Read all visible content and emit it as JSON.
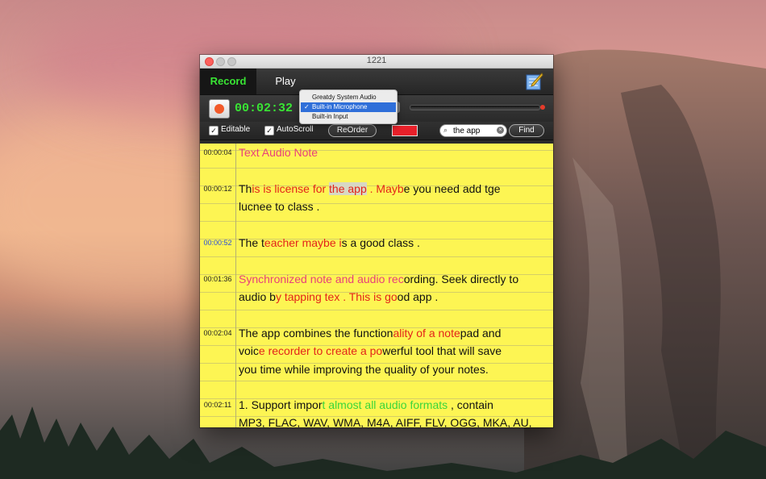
{
  "window": {
    "title": "1221"
  },
  "tabs": {
    "record": "Record",
    "play": "Play"
  },
  "transport": {
    "timer": "00:02:32"
  },
  "options": {
    "editable_label": "Editable",
    "autoscroll_label": "AutoScroll",
    "reorder_label": "ReOrder",
    "find_label": "Find",
    "search_value": "the app",
    "highlight_color": "#e8202a"
  },
  "input_menu": {
    "items": [
      "Greatdy System Audio",
      "Built-in Microphone",
      "Built-in Input"
    ],
    "selected": "Built-in Microphone"
  },
  "notes": [
    {
      "time": "00:00:04",
      "segments": [
        {
          "t": "Text Audio Note",
          "c": "pink"
        }
      ]
    },
    {
      "time": "00:00:12",
      "segments": [
        {
          "t": "Th",
          "c": "black"
        },
        {
          "t": "is is license for ",
          "c": "red"
        },
        {
          "t": "the app",
          "c": "red",
          "hl": true
        },
        {
          "t": "  .  Mayb",
          "c": "red"
        },
        {
          "t": "e you need add tge",
          "c": "black"
        },
        {
          "br": true
        },
        {
          "t": "lucnee to class .",
          "c": "black"
        }
      ]
    },
    {
      "time": "00:00:52",
      "time_color": "blue",
      "segments": [
        {
          "t": "The t",
          "c": "black"
        },
        {
          "t": "eacher maybe i",
          "c": "red"
        },
        {
          "t": "s a good class .",
          "c": "black"
        }
      ]
    },
    {
      "time": "00:01:36",
      "segments": [
        {
          "t": "Synchronized note and audio rec",
          "c": "pink"
        },
        {
          "t": "ording. Seek directly to",
          "c": "black"
        },
        {
          "br": true
        },
        {
          "t": "audio b",
          "c": "black"
        },
        {
          "t": "y tapping tex . This is go",
          "c": "red"
        },
        {
          "t": "od app .",
          "c": "black"
        }
      ]
    },
    {
      "time": "00:02:04",
      "segments": [
        {
          "t": "The app combines the function",
          "c": "black"
        },
        {
          "t": "ality of a note",
          "c": "red"
        },
        {
          "t": "pad and",
          "c": "black"
        },
        {
          "br": true
        },
        {
          "t": "voic",
          "c": "black"
        },
        {
          "t": "e recorder to create a po",
          "c": "red"
        },
        {
          "t": "werful tool that will save",
          "c": "black"
        },
        {
          "br": true
        },
        {
          "t": "you time while improving the quality of your notes.",
          "c": "black"
        }
      ]
    },
    {
      "time": "00:02:11",
      "segments": [
        {
          "t": "1. Support impor",
          "c": "black"
        },
        {
          "t": "t almost all audio formats",
          "c": "green"
        },
        {
          "t": " ,  contain",
          "c": "black"
        },
        {
          "br": true
        },
        {
          "t": "MP3, FLAC, WAV, WMA, M4A, AIFF, FLV, OGG, MKA, AU,",
          "c": "black"
        }
      ]
    }
  ]
}
